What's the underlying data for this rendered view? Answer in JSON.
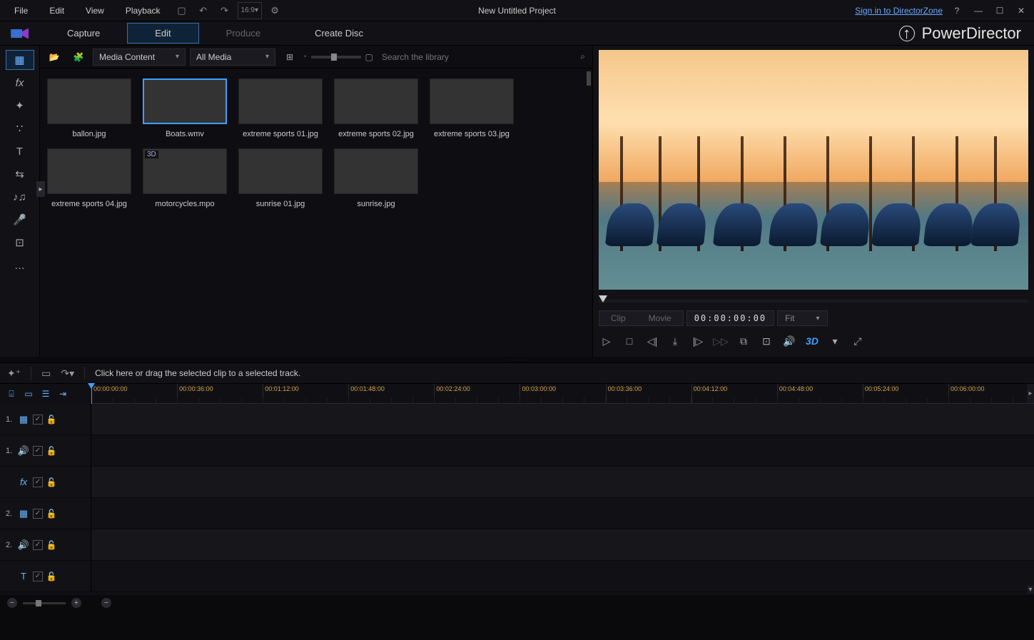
{
  "menu": {
    "items": [
      "File",
      "Edit",
      "View",
      "Playback"
    ]
  },
  "aspect_label": "16:9",
  "project_title": "New Untitled Project",
  "signin_label": "Sign in to DirectorZone",
  "brand": "PowerDirector",
  "tabs": {
    "items": [
      "Capture",
      "Edit",
      "Produce",
      "Create Disc"
    ],
    "active": 1
  },
  "library": {
    "folder_dd": "Media Content",
    "filter_dd": "All Media",
    "search_placeholder": "Search the library",
    "items": [
      {
        "label": "ballon.jpg",
        "art": "art-balloon",
        "selected": false,
        "badge3d": false
      },
      {
        "label": "Boats.wmv",
        "art": "art-boats",
        "selected": true,
        "badge3d": false
      },
      {
        "label": "extreme sports 01.jpg",
        "art": "art-sport1",
        "selected": false,
        "badge3d": false
      },
      {
        "label": "extreme sports 02.jpg",
        "art": "art-sport2",
        "selected": false,
        "badge3d": false
      },
      {
        "label": "extreme sports 03.jpg",
        "art": "art-sport3",
        "selected": false,
        "badge3d": false
      },
      {
        "label": "extreme sports 04.jpg",
        "art": "art-sport4",
        "selected": false,
        "badge3d": false
      },
      {
        "label": "motorcycles.mpo",
        "art": "art-moto",
        "selected": false,
        "badge3d": true
      },
      {
        "label": "sunrise 01.jpg",
        "art": "art-sunrise1",
        "selected": false,
        "badge3d": false
      },
      {
        "label": "sunrise.jpg",
        "art": "art-sunrise2",
        "selected": false,
        "badge3d": false
      }
    ]
  },
  "preview": {
    "clip_label": "Clip",
    "movie_label": "Movie",
    "timecode": "00:00:00:00",
    "fit_label": "Fit",
    "threeD": "3D"
  },
  "track_hint": "Click here or drag the selected clip to a selected track.",
  "ruler": {
    "times": [
      "00:00:00:00",
      "00:00:36:00",
      "00:01:12:00",
      "00:01:48:00",
      "00:02:24:00",
      "00:03:00:00",
      "00:03:36:00",
      "00:04:12:00",
      "00:04:48:00",
      "00:05:24:00",
      "00:06:00:00"
    ]
  },
  "tracks": [
    {
      "num": "1.",
      "icon": "film"
    },
    {
      "num": "1.",
      "icon": "audio"
    },
    {
      "num": "",
      "icon": "fx"
    },
    {
      "num": "2.",
      "icon": "film"
    },
    {
      "num": "2.",
      "icon": "audio"
    },
    {
      "num": "",
      "icon": "title"
    }
  ]
}
